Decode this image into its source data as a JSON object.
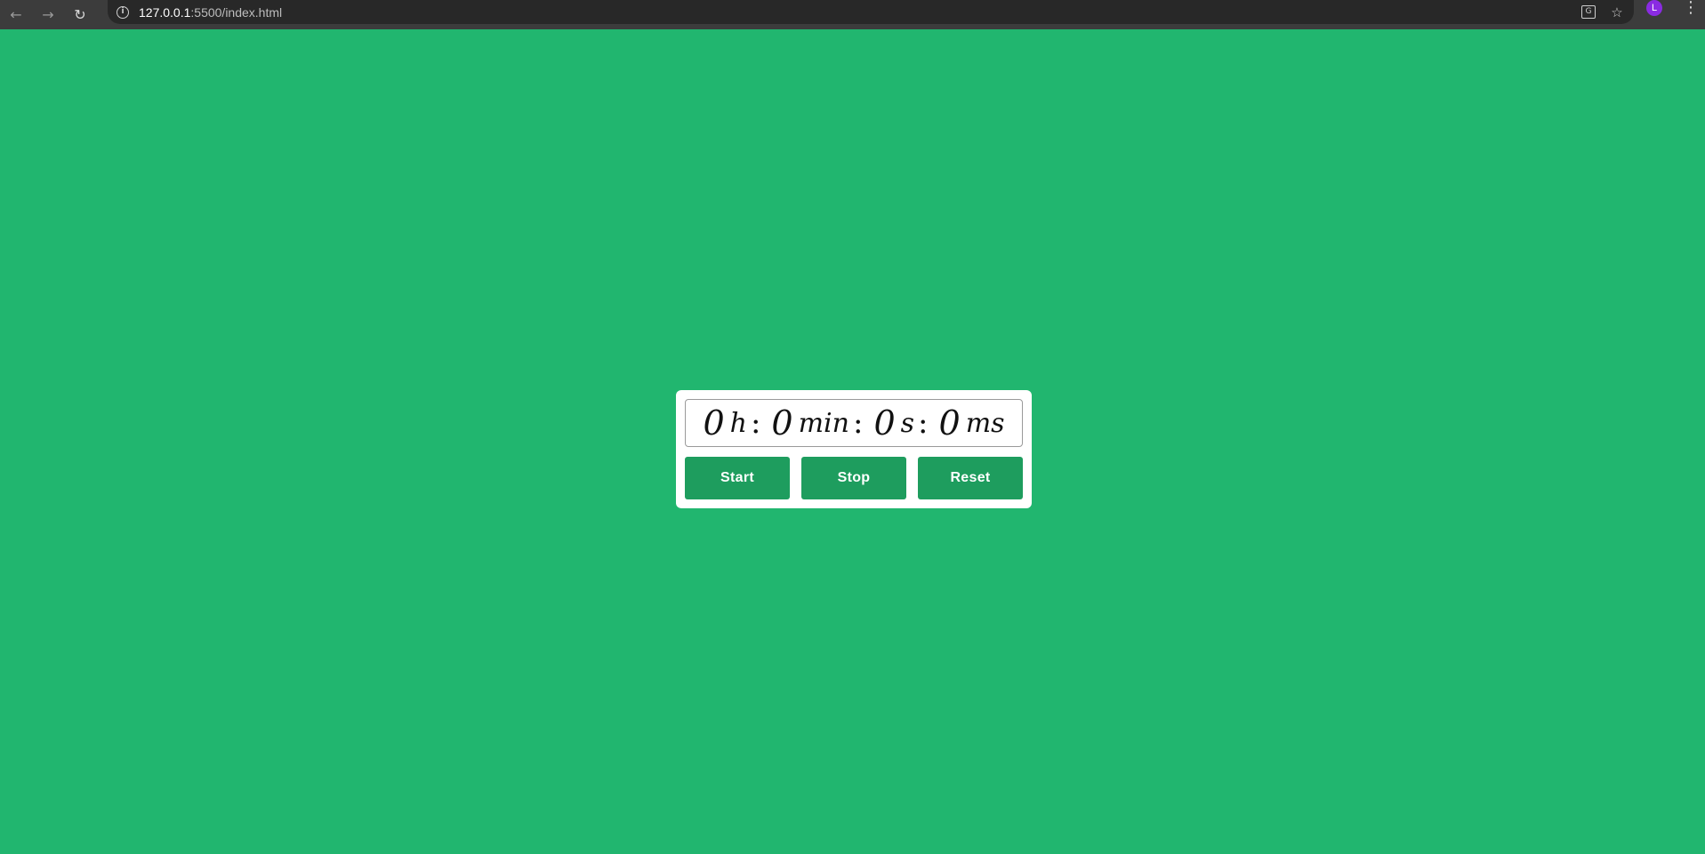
{
  "browser": {
    "url_host": "127.0.0.1",
    "url_path": ":5500/index.html",
    "avatar_letter": "L",
    "avatar_color": "#8a2be2"
  },
  "page": {
    "background_color": "#21b66f"
  },
  "stopwatch": {
    "hours": "0",
    "hours_unit": "h",
    "minutes": "0",
    "minutes_unit": "min",
    "seconds": "0",
    "seconds_unit": "s",
    "milliseconds": "0",
    "milliseconds_unit": "ms",
    "separator": ":",
    "start_label": "Start",
    "stop_label": "Stop",
    "reset_label": "Reset",
    "button_color": "#1e9d5e"
  }
}
